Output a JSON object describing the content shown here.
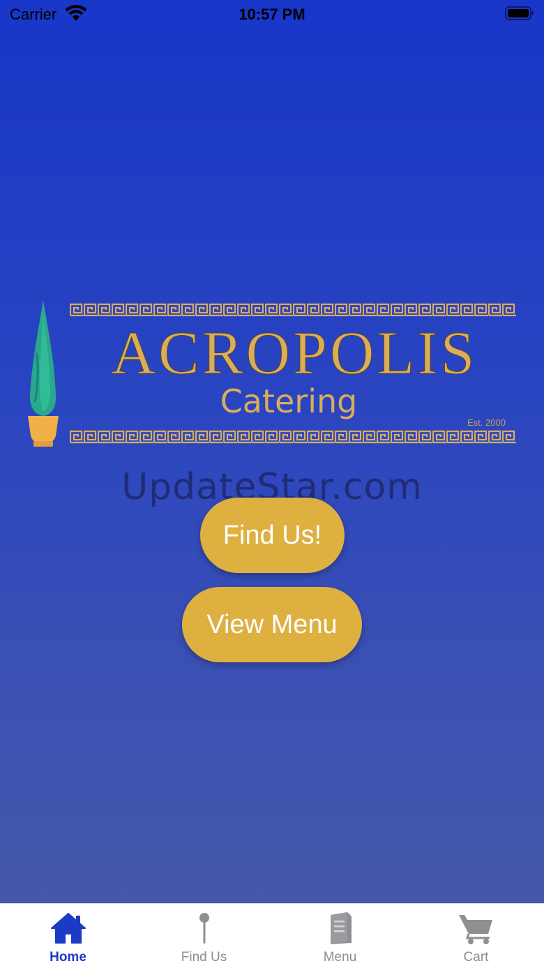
{
  "status_bar": {
    "carrier": "Carrier",
    "time": "10:57 PM"
  },
  "logo": {
    "title": "ACROPOLIS",
    "subtitle": "Catering",
    "est": "Est. 2000"
  },
  "watermark": "UpdateStar.com",
  "buttons": {
    "find_us": "Find Us!",
    "view_menu": "View Menu"
  },
  "tab_bar": {
    "tabs": [
      {
        "label": "Home",
        "icon": "home-icon",
        "active": true
      },
      {
        "label": "Find Us",
        "icon": "pin-icon",
        "active": false
      },
      {
        "label": "Menu",
        "icon": "menu-book-icon",
        "active": false
      },
      {
        "label": "Cart",
        "icon": "cart-icon",
        "active": false
      }
    ]
  },
  "colors": {
    "background_top": "#1836c8",
    "background_bottom": "#4457aa",
    "button": "#ddb040",
    "logo_gold": "#d9ad5b",
    "tab_active": "#1b3bc4",
    "tab_inactive": "#8e8e93"
  }
}
